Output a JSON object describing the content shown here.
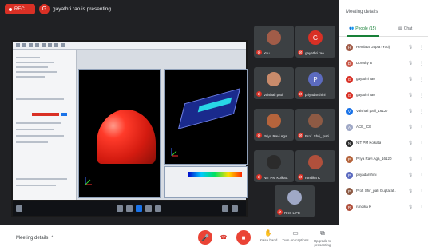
{
  "topbar": {
    "rec_label": "REC",
    "presenter_initial": "G",
    "presenting_text": "gayathri rao is presenting"
  },
  "tiles": [
    {
      "name": "You",
      "initial": "",
      "color": "#a15c48"
    },
    {
      "name": "gayathri rao",
      "initial": "G",
      "color": "#d93025"
    },
    {
      "name": "Vaishali patil",
      "initial": "",
      "color": "#c98b6b"
    },
    {
      "name": "priyadarshini",
      "initial": "P",
      "color": "#5c6bc0"
    },
    {
      "name": "Priya Ravi Aga..",
      "initial": "",
      "color": "#b5643c"
    },
    {
      "name": "Prof. Shri_ pati..",
      "initial": "",
      "color": "#8d5a44"
    },
    {
      "name": "NIT PM Kolkat..",
      "initial": "",
      "color": "#2b2b2b"
    },
    {
      "name": "rundika K",
      "initial": "",
      "color": "#b0503c"
    },
    {
      "name": "RKS LIFE",
      "initial": "",
      "color": "#9fa8c6"
    }
  ],
  "bottombar": {
    "meeting_details_label": "Meeting details",
    "actions": [
      {
        "label": "Raise hand",
        "icon": "hand-icon"
      },
      {
        "label": "Turn on captions",
        "icon": "captions-icon"
      },
      {
        "label": "Upgrade to presenting",
        "icon": "present-icon"
      }
    ]
  },
  "sidepanel": {
    "title": "Meeting details",
    "tab_people": "People (15)",
    "tab_chat": "Chat",
    "participants": [
      {
        "name": "Hemlata Gupta (You)",
        "initial": "H",
        "color": "#a15c48"
      },
      {
        "name": "Dorothy B",
        "initial": "D",
        "color": "#c9594a"
      },
      {
        "name": "gayathri rao",
        "initial": "G",
        "color": "#d93025"
      },
      {
        "name": "gayathri rao",
        "initial": "G",
        "color": "#d93025"
      },
      {
        "name": "Vaishali patil_16127",
        "initial": "V",
        "color": "#1a73e8"
      },
      {
        "name": "ACE_ICE",
        "initial": "A",
        "color": "#9fa8c6"
      },
      {
        "name": "NIT PM Kolkata",
        "initial": "N",
        "color": "#2b2b2b"
      },
      {
        "name": "Priya Ravi Aga_16120",
        "initial": "P",
        "color": "#b5643c"
      },
      {
        "name": "priyadarshini",
        "initial": "P",
        "color": "#5c6bc0"
      },
      {
        "name": "Prof. Shri_pati Guptarat..",
        "initial": "P",
        "color": "#8d5a44"
      },
      {
        "name": "rundika K",
        "initial": "R",
        "color": "#b0503c"
      }
    ]
  }
}
